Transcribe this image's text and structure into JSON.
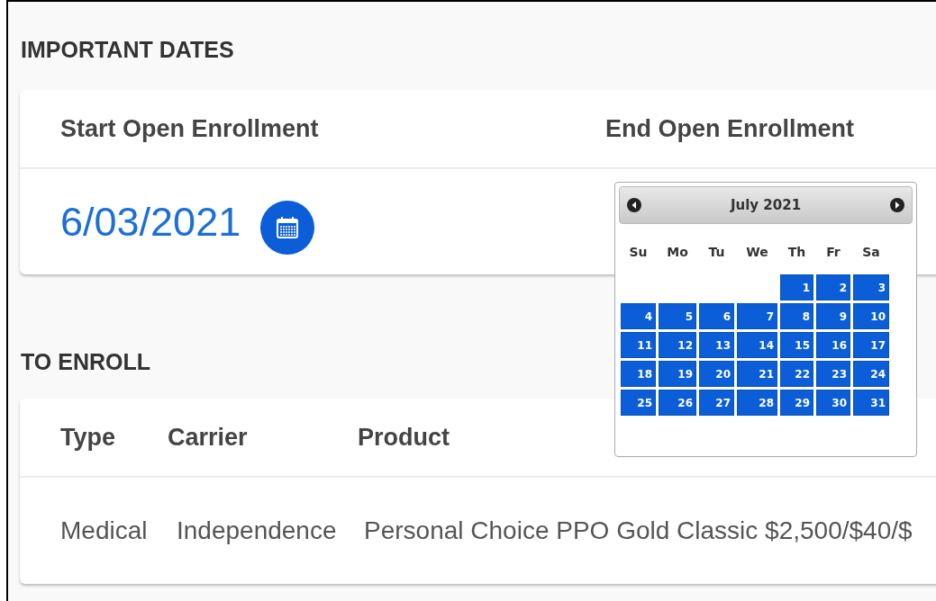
{
  "important_dates": {
    "title": "IMPORTANT DATES",
    "columns": [
      "Start Open Enrollment",
      "End Open Enrollment"
    ],
    "start_date": "6/03/2021"
  },
  "datepicker": {
    "month": "July 2021",
    "weekdays": [
      "Su",
      "Mo",
      "Tu",
      "We",
      "Th",
      "Fr",
      "Sa"
    ],
    "weeks": [
      [
        "1",
        "2",
        "3"
      ],
      [
        "4",
        "5",
        "6",
        "7",
        "8",
        "9",
        "10"
      ],
      [
        "11",
        "12",
        "13",
        "14",
        "15",
        "16",
        "17"
      ],
      [
        "18",
        "19",
        "20",
        "21",
        "22",
        "23",
        "24"
      ],
      [
        "25",
        "26",
        "27",
        "28",
        "29",
        "30",
        "31"
      ]
    ]
  },
  "to_enroll": {
    "title": "TO ENROLL",
    "columns": [
      "Type",
      "Carrier",
      "Product"
    ],
    "rows": [
      [
        "Medical",
        "Independence",
        "Personal Choice PPO Gold Classic $2,500/$40/$"
      ]
    ]
  }
}
